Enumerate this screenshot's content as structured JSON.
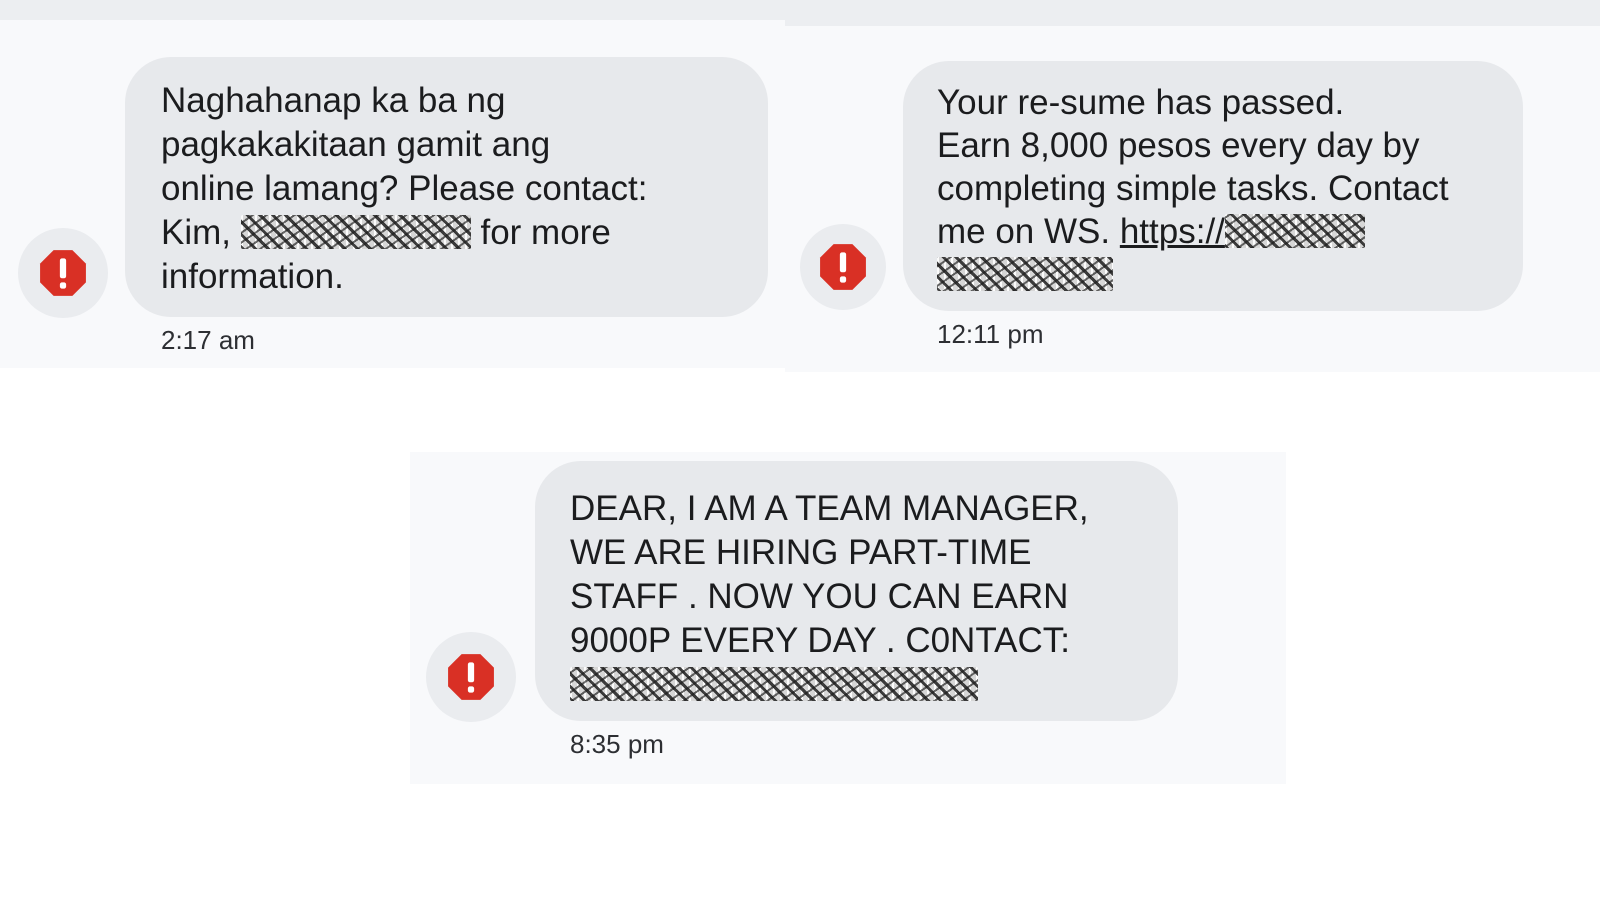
{
  "conversations": [
    {
      "message_lines": [
        "Naghahanap ka ba ng",
        "pagkakakitaan gamit ang",
        "online lamang? Please contact:",
        "Kim,",
        "for more",
        "information."
      ],
      "timestamp": "2:17 am",
      "status_icon": "exclamation-octagon-icon"
    },
    {
      "message_lines": [
        "Your re-sume has passed.",
        "Earn 8,000 pesos every day by",
        "completing simple tasks. Contact",
        "me on WS.",
        "https://"
      ],
      "timestamp": "12:11 pm",
      "status_icon": "exclamation-octagon-icon"
    },
    {
      "message_lines": [
        "DEAR, I AM A TEAM MANAGER,",
        "WE ARE HIRING PART-TIME",
        "STAFF . NOW YOU CAN EARN",
        "9000P EVERY DAY . C0NTACT:"
      ],
      "timestamp": "8:35 pm",
      "status_icon": "exclamation-octagon-icon"
    }
  ],
  "colors": {
    "warning_red": "#d93025",
    "bubble_gray": "#e7e9ec",
    "panel_bg": "#f8f9fb"
  }
}
